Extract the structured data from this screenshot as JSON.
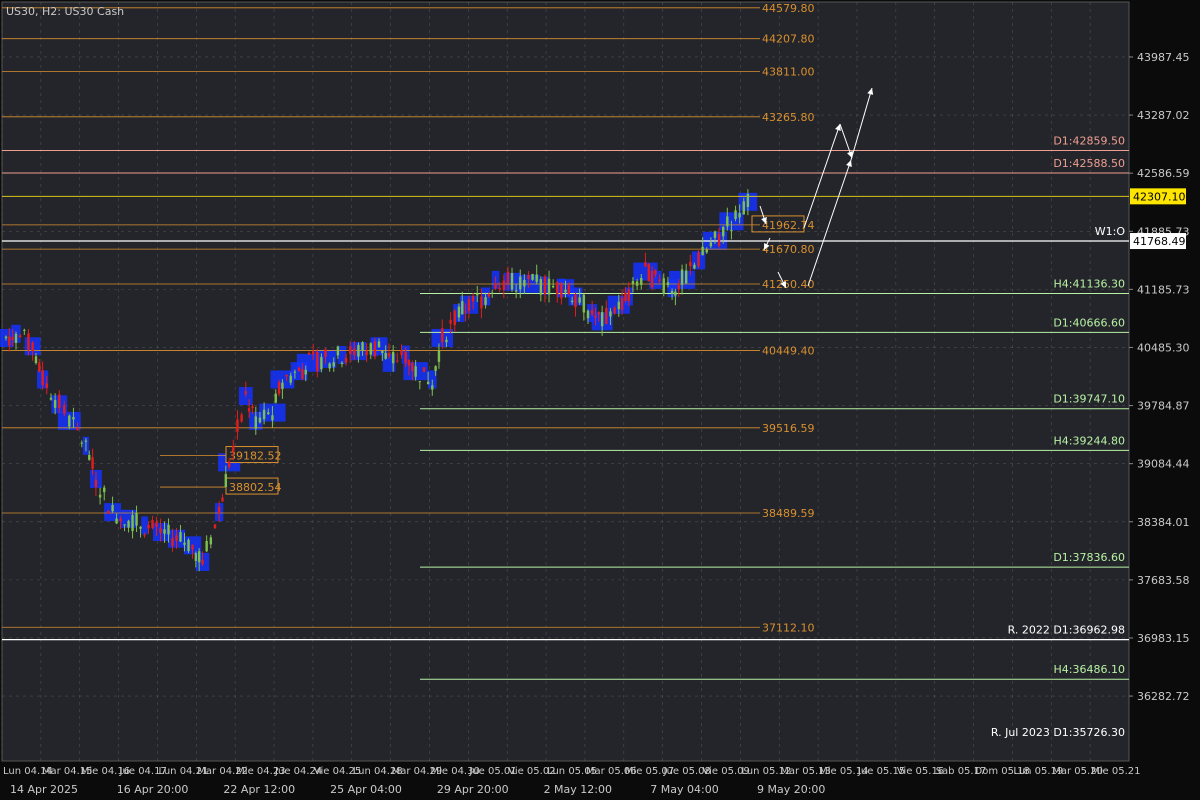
{
  "window": {
    "symbol_title": "US30, H2:  US30 Cash"
  },
  "colors": {
    "background": "#0b0b0b",
    "plot_bg": "#24252a",
    "grid": "#6a6a6a",
    "axis_text": "#c9c9c9",
    "level_orange": "#d8902f",
    "level_salmon": "#ee9f92",
    "level_green": "#b7f2a4",
    "level_white": "#ffffff",
    "current_yellow": "#ffe600",
    "candle_up": "#7cc14f",
    "candle_down": "#e11d1d",
    "volume_profile": "#1432ff"
  },
  "chart_data": {
    "type": "line",
    "title": "",
    "ylim": [
      35500,
      44650
    ],
    "y_axis_ticks": [
      "43987.45",
      "43287.02",
      "42586.59",
      "41885.73",
      "41185.73",
      "40485.30",
      "39784.87",
      "39084.44",
      "38384.01",
      "37683.58",
      "36983.15",
      "36282.72"
    ],
    "x_axis_day_labels": [
      "Lun 04.14",
      "Mar 04.15",
      "Mie 04.16",
      "Jue 04.17",
      "Lun 04.21",
      "Mar 04.22",
      "Mie 04.23",
      "Jue 04.24",
      "Vie 04.25",
      "Lun 04.28",
      "Mar 04.29",
      "Mie 04.30",
      "Jue 05.01",
      "Vie 05.02",
      "Lun 05.05",
      "Mar 05.06",
      "Mie 05.07",
      "Jue 05.08",
      "Vie 05.09",
      "Lun 05.12",
      "Mar 05.13",
      "Mie 05.14",
      "Jue 05.15",
      "Vie 05.16",
      "Sab 05.17",
      "Dom 05.18",
      "Lun 05.19",
      "Mar 05.20",
      "Mie 05.21"
    ],
    "x_axis_time_labels": [
      "14 Apr 2025",
      "16 Apr 20:00",
      "22 Apr 12:00",
      "25 Apr 04:00",
      "29 Apr 20:00",
      "2 May 12:00",
      "7 May 04:00",
      "9 May 20:00"
    ],
    "current_price": "42307.10",
    "price_line_label": "41768.49",
    "levels_center": [
      {
        "value": 44579.8,
        "label": "44579.80"
      },
      {
        "value": 44207.8,
        "label": "44207.80"
      },
      {
        "value": 43811.0,
        "label": "43811.00"
      },
      {
        "value": 43265.8,
        "label": "43265.80"
      },
      {
        "value": 41962.74,
        "label": "41962.74",
        "boxed": true
      },
      {
        "value": 41670.8,
        "label": "41670.80"
      },
      {
        "value": 41250.4,
        "label": "41250.40"
      },
      {
        "value": 40449.4,
        "label": "40449.40"
      },
      {
        "value": 39516.59,
        "label": "39516.59"
      },
      {
        "value": 38489.59,
        "label": "38489.59"
      },
      {
        "value": 37112.1,
        "label": "37112.10"
      }
    ],
    "levels_right": [
      {
        "value": 42859.5,
        "label": "D1:42859.50",
        "color": "salmon"
      },
      {
        "value": 42588.5,
        "label": "D1:42588.50",
        "color": "salmon"
      },
      {
        "value": 41768.49,
        "label": "W1:O",
        "color": "white"
      },
      {
        "value": 41136.3,
        "label": "H4:41136.30",
        "color": "green"
      },
      {
        "value": 40666.6,
        "label": "D1:40666.60",
        "color": "green"
      },
      {
        "value": 39747.1,
        "label": "D1:39747.10",
        "color": "green"
      },
      {
        "value": 39244.8,
        "label": "H4:39244.80",
        "color": "green"
      },
      {
        "value": 37836.6,
        "label": "D1:37836.60",
        "color": "green"
      },
      {
        "value": 36962.98,
        "label": "R. 2022 D1:36962.98",
        "color": "white"
      },
      {
        "value": 36486.1,
        "label": "H4:36486.10",
        "color": "green"
      },
      {
        "value": 35726.3,
        "label": "R. Jul 2023 D1:35726.30",
        "color": "none"
      }
    ],
    "left_boxed_labels": [
      {
        "value": 39182.52,
        "label": "39182.52"
      },
      {
        "value": 38802.54,
        "label": "38802.54"
      }
    ],
    "close_path": [
      [
        "2025-04-14",
        40600
      ],
      [
        "2025-04-14",
        40650
      ],
      [
        "2025-04-15",
        40500
      ],
      [
        "2025-04-15",
        40100
      ],
      [
        "2025-04-16",
        39800
      ],
      [
        "2025-04-16",
        39600
      ],
      [
        "2025-04-17",
        39300
      ],
      [
        "2025-04-17",
        38900
      ],
      [
        "2025-04-18",
        38500
      ],
      [
        "2025-04-21",
        38100
      ],
      [
        "2025-04-21",
        37900
      ],
      [
        "2025-04-22",
        38500
      ],
      [
        "2025-04-22",
        39100
      ],
      [
        "2025-04-23",
        39900
      ],
      [
        "2025-04-23",
        39600
      ],
      [
        "2025-04-24",
        39700
      ],
      [
        "2025-04-24",
        40100
      ],
      [
        "2025-04-25",
        40200
      ],
      [
        "2025-04-25",
        40300
      ],
      [
        "2025-04-28",
        40500
      ],
      [
        "2025-04-28",
        40300
      ],
      [
        "2025-04-29",
        40400
      ],
      [
        "2025-04-29",
        40200
      ],
      [
        "2025-04-30",
        40100
      ],
      [
        "2025-04-30",
        40600
      ],
      [
        "2025-05-01",
        40900
      ],
      [
        "2025-05-01",
        41000
      ],
      [
        "2025-05-02",
        41100
      ],
      [
        "2025-05-02",
        41300
      ],
      [
        "2025-05-05",
        41200
      ],
      [
        "2025-05-05",
        41100
      ],
      [
        "2025-05-06",
        40900
      ],
      [
        "2025-05-06",
        40800
      ],
      [
        "2025-05-07",
        41000
      ],
      [
        "2025-05-07",
        41100
      ],
      [
        "2025-05-08",
        41400
      ],
      [
        "2025-05-08",
        41300
      ],
      [
        "2025-05-09",
        41200
      ],
      [
        "2025-05-09",
        41300
      ],
      [
        "2025-05-12",
        42300
      ]
    ]
  }
}
